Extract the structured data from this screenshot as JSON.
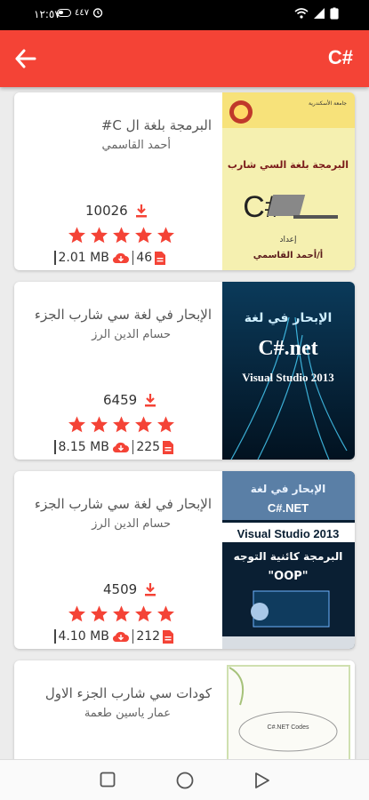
{
  "status_bar": {
    "time": "١٢:٥٧",
    "extra": "٤٤٧"
  },
  "app_bar": {
    "title": "C#"
  },
  "colors": {
    "accent": "#f44336",
    "star": "#f44336"
  },
  "books": [
    {
      "title": "البرمجة بلغة ال C#",
      "author": "أحمد القاسمي",
      "downloads": "10026",
      "size": "2.01 MB",
      "pages": "46",
      "rating": 5,
      "cover": {
        "header": "جامعة الأسكندرية",
        "title": "البرمجة بلغة السي شارب",
        "big": "C#",
        "by": "إعداد",
        "author": "أ/أحمد القاسمي"
      }
    },
    {
      "title": "الإبحار في لغة سي شارب الجزء",
      "author": "حسام الدين الرز",
      "downloads": "6459",
      "size": "8.15 MB",
      "pages": "225",
      "rating": 5,
      "cover": {
        "header": "الإبحار في لغة",
        "big": "C#.net",
        "sub": "Visual Studio 2013"
      }
    },
    {
      "title": "الإبحار في لغة سي شارب الجزء",
      "author": "حسام الدين الرز",
      "downloads": "4509",
      "size": "4.10 MB",
      "pages": "212",
      "rating": 5,
      "cover": {
        "header": "الإبحار في لغة",
        "big": "C#.NET",
        "sub": "Visual Studio 2013",
        "line2": "البرمجة كائنية التوجه",
        "line3": "\"OOP\""
      }
    },
    {
      "title": "كودات سي شارب الجزء الاول",
      "author": "عمار ياسين طعمة",
      "cover": {
        "title": "C#.NET Codes"
      }
    }
  ]
}
